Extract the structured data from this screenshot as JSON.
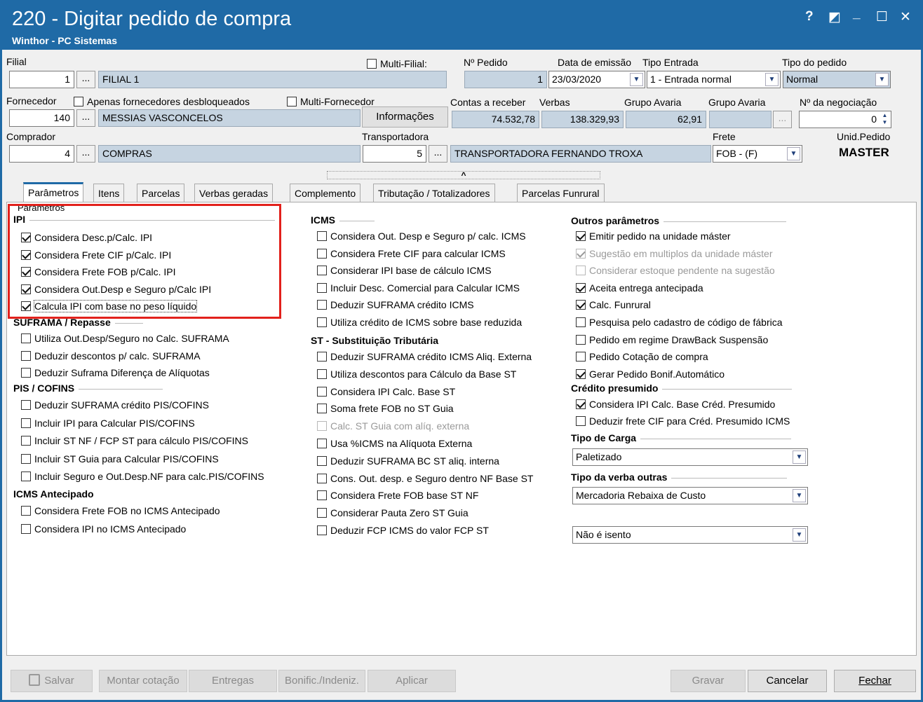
{
  "window": {
    "title": "220 - Digitar pedido de compra",
    "subtitle": "Winthor - PC Sistemas",
    "controls": {
      "help": "?",
      "restore": "◩",
      "minimize": "_",
      "maximize": "☐",
      "close": "✕"
    }
  },
  "header": {
    "filial_label": "Filial",
    "filial_code": "1",
    "filial_name": "FILIAL 1",
    "multi_filial_label": "Multi-Filial:",
    "multi_filial_checked": false,
    "num_pedido_label": "Nº Pedido",
    "num_pedido": "1",
    "data_emissao_label": "Data de emissão",
    "data_emissao": "23/03/2020",
    "tipo_entrada_label": "Tipo Entrada",
    "tipo_entrada": "1 - Entrada normal",
    "tipo_pedido_label": "Tipo do pedido",
    "tipo_pedido": "Normal",
    "fornecedor_label": "Fornecedor",
    "apenas_desbloq_label": "Apenas fornecedores desbloqueados",
    "multi_fornecedor_label": "Multi-Fornecedor",
    "fornecedor_code": "140",
    "fornecedor_name": "MESSIAS VASCONCELOS",
    "informacoes_button": "Informações",
    "contas_receber_label": "Contas a receber",
    "contas_receber": "74.532,78",
    "verbas_label": "Verbas",
    "verbas": "138.329,93",
    "grupo_avaria_label_1": "Grupo Avaria",
    "grupo_avaria_1": "62,91",
    "grupo_avaria_label_2": "Grupo Avaria",
    "grupo_avaria_2": "",
    "negociacao_label": "Nº da negociação",
    "negociacao": "0",
    "comprador_label": "Comprador",
    "comprador_code": "4",
    "comprador_name": "COMPRAS",
    "transportadora_label": "Transportadora",
    "transportadora_code": "5",
    "transportadora_name": "TRANSPORTADORA FERNANDO TROXA",
    "frete_label": "Frete",
    "frete": "FOB - (F)",
    "unid_pedido_label": "Unid.Pedido",
    "unid_pedido": "MASTER",
    "dots": "...",
    "collapse_arrow": "^"
  },
  "tabs": [
    "Parâmetros",
    "Itens",
    "Parcelas",
    "Verbas geradas",
    "Complemento",
    "Tributação / Totalizadores",
    "Parcelas Funrural"
  ],
  "panel": {
    "caption": "Parâmetros",
    "ipi": {
      "title": "IPI",
      "items": [
        {
          "label": "Considera Desc.p/Calc. IPI",
          "checked": true
        },
        {
          "label": "Considera Frete CIF p/Calc. IPI",
          "checked": true
        },
        {
          "label": "Considera Frete FOB p/Calc. IPI",
          "checked": true
        },
        {
          "label": "Considera Out.Desp e Seguro p/Calc IPI",
          "checked": true
        },
        {
          "label": "Calcula IPI com base no peso líquido",
          "checked": true
        }
      ]
    },
    "suframa": {
      "title": "SUFRAMA / Repasse",
      "items": [
        {
          "label": "Utiliza Out.Desp/Seguro no Calc. SUFRAMA",
          "checked": false
        },
        {
          "label": "Deduzir descontos p/ calc. SUFRAMA",
          "checked": false
        },
        {
          "label": "Deduzir Suframa Diferença de Alíquotas",
          "checked": false
        }
      ]
    },
    "pis": {
      "title": "PIS / COFINS",
      "items": [
        {
          "label": "Deduzir SUFRAMA crédito PIS/COFINS",
          "checked": false
        },
        {
          "label": "Incluir IPI para Calcular PIS/COFINS",
          "checked": false
        },
        {
          "label": "Incluir ST NF / FCP ST para cálculo PIS/COFINS",
          "checked": false
        },
        {
          "label": "Incluir ST Guia para Calcular PIS/COFINS",
          "checked": false
        },
        {
          "label": "Incluir Seguro e Out.Desp.NF para calc.PIS/COFINS",
          "checked": false
        }
      ]
    },
    "icms_antecipado": {
      "title": "ICMS Antecipado",
      "items": [
        {
          "label": "Considera Frete FOB no ICMS Antecipado",
          "checked": false
        },
        {
          "label": "Considera IPI no ICMS Antecipado",
          "checked": false
        }
      ]
    },
    "icms": {
      "title": "ICMS",
      "items": [
        {
          "label": "Considera Out. Desp e Seguro p/ calc. ICMS",
          "checked": false
        },
        {
          "label": "Considera Frete CIF para calcular ICMS",
          "checked": false
        },
        {
          "label": "Considerar IPI base de cálculo ICMS",
          "checked": false
        },
        {
          "label": "Incluir Desc. Comercial  para Calcular ICMS",
          "checked": false
        },
        {
          "label": "Deduzir SUFRAMA crédito ICMS",
          "checked": false
        },
        {
          "label": "Utiliza crédito de ICMS sobre base reduzida",
          "checked": false
        }
      ]
    },
    "st": {
      "title": "ST - Substituição Tributária",
      "items": [
        {
          "label": "Deduzir SUFRAMA crédito ICMS Aliq. Externa",
          "checked": false
        },
        {
          "label": "Utiliza descontos para Cálculo da Base ST",
          "checked": false
        },
        {
          "label": "Considera IPI Calc. Base ST",
          "checked": false
        },
        {
          "label": "Soma frete FOB no ST Guia",
          "checked": false
        },
        {
          "label": "Calc. ST Guia com alíq. externa",
          "checked": false,
          "disabled": true
        },
        {
          "label": "Usa %ICMS na Alíquota Externa",
          "checked": false
        },
        {
          "label": "Deduzir SUFRAMA BC ST aliq. interna",
          "checked": false
        },
        {
          "label": "Cons. Out. desp. e Seguro dentro NF Base ST",
          "checked": false
        },
        {
          "label": "Considera Frete FOB base ST NF",
          "checked": false
        },
        {
          "label": "Considerar Pauta Zero ST Guia",
          "checked": false
        },
        {
          "label": "Deduzir FCP ICMS do valor FCP ST",
          "checked": false
        }
      ]
    },
    "outros": {
      "title": "Outros parâmetros",
      "items": [
        {
          "label": "Emitir pedido na unidade máster",
          "checked": true
        },
        {
          "label": "Sugestão em multiplos da unidade máster",
          "checked": true,
          "disabled": true
        },
        {
          "label": "Considerar estoque pendente na sugestão",
          "checked": false,
          "disabled": true
        },
        {
          "label": "Aceita entrega antecipada",
          "checked": true
        },
        {
          "label": "Calc. Funrural",
          "checked": true
        },
        {
          "label": "Pesquisa pelo cadastro de código de fábrica",
          "checked": false
        },
        {
          "label": "Pedido em regime DrawBack Suspensão",
          "checked": false
        },
        {
          "label": "Pedido Cotação de compra",
          "checked": false
        },
        {
          "label": "Gerar Pedido Bonif.Automático",
          "checked": true
        }
      ]
    },
    "credito": {
      "title": "Crédito presumido",
      "items": [
        {
          "label": "Considera IPI Calc. Base Créd. Presumido",
          "checked": true
        },
        {
          "label": "Deduzir frete CIF para Créd. Presumido ICMS",
          "checked": false
        }
      ]
    },
    "tipo_carga": {
      "title": "Tipo de Carga",
      "value": "Paletizado"
    },
    "tipo_verba": {
      "title": "Tipo da verba outras",
      "value": "Mercadoria Rebaixa de Custo"
    },
    "isento": {
      "value": "Não é isento"
    }
  },
  "footer": {
    "salvar": "Salvar",
    "montar_cotacao": "Montar cotação",
    "entregas": "Entregas",
    "bonific": "Bonific./Indeniz.",
    "aplicar": "Aplicar",
    "gravar": "Gravar",
    "cancelar": "Cancelar",
    "fechar": "Fechar"
  },
  "colors": {
    "title_bar": "#1f6aa6",
    "highlight": "#e2211c",
    "readonly_field": "#c6d4e1"
  }
}
